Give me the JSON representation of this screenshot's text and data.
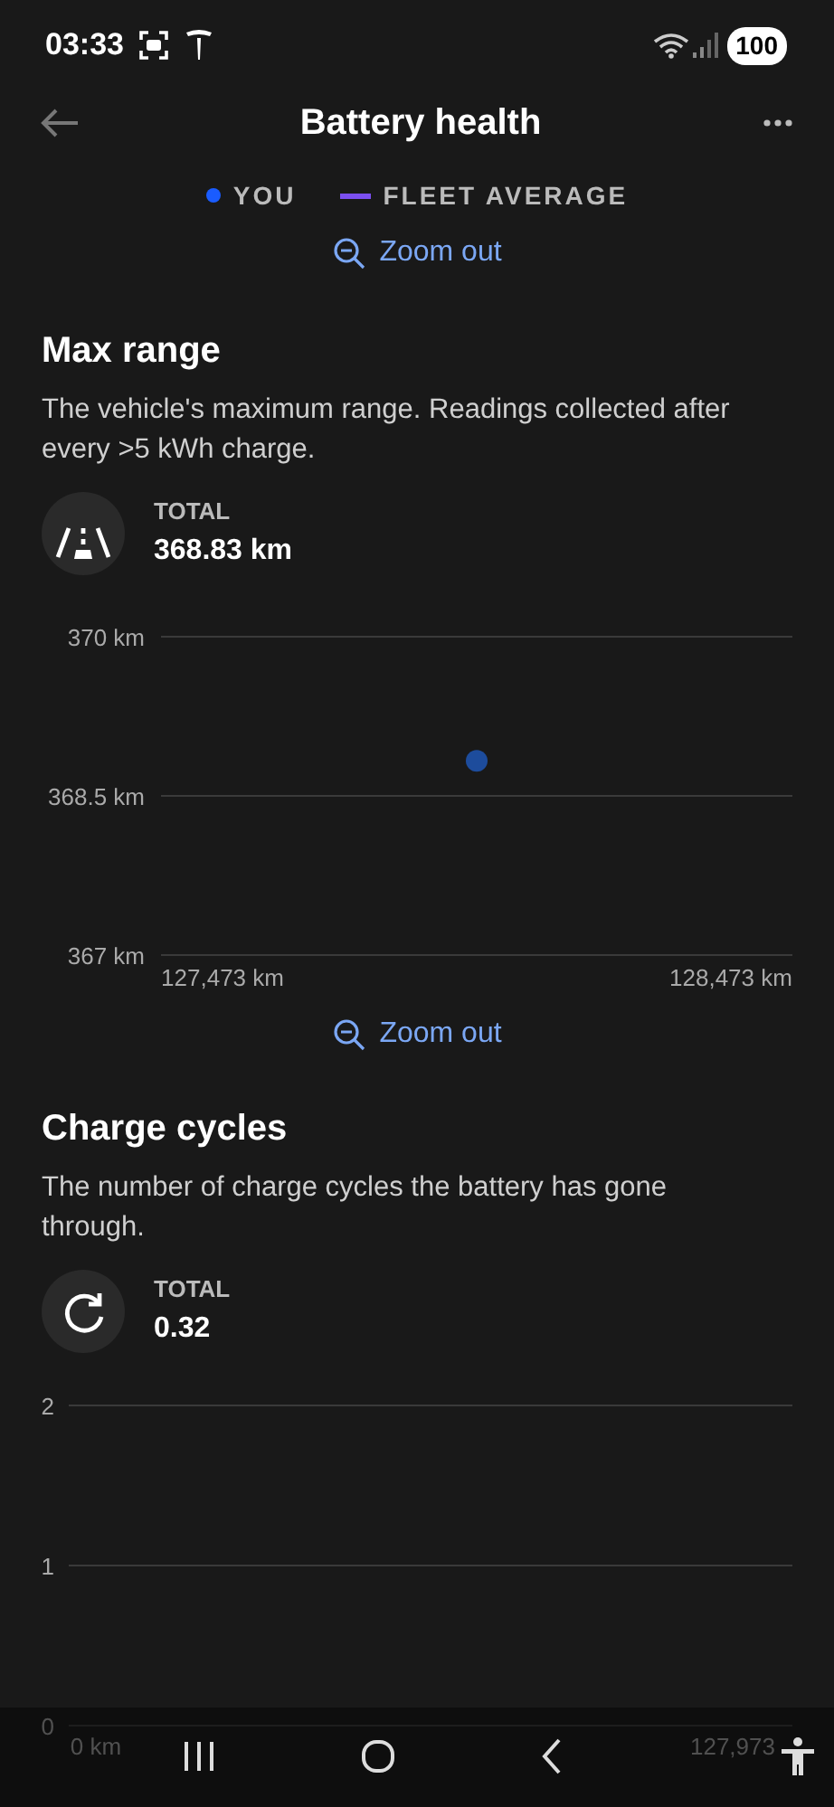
{
  "status_bar": {
    "time": "03:33",
    "battery": "100"
  },
  "header": {
    "title": "Battery health"
  },
  "legend": [
    {
      "label": "YOU",
      "color": "#1a5cff",
      "kind": "dot"
    },
    {
      "label": "FLEET AVERAGE",
      "color": "#7b4ff0",
      "kind": "line"
    }
  ],
  "sections": [
    {
      "zoom_link": "Zoom out",
      "title": "Max range",
      "description": "The vehicle's maximum range. Readings collected after every >5 kWh charge.",
      "total_label": "TOTAL",
      "total_value": "368.83 km",
      "chart_data": {
        "type": "scatter",
        "xlim": [
          127352,
          128594
        ],
        "ylim": [
          367,
          370
        ],
        "yticks": [
          {
            "value": 367,
            "label": "367 km"
          },
          {
            "value": 368.5,
            "label": "368.5 km"
          },
          {
            "value": 370,
            "label": "370 km"
          }
        ],
        "xticks": [
          {
            "value": 127473,
            "label": "127,473 km"
          },
          {
            "value": 128473,
            "label": "128,473 km"
          }
        ],
        "series": [
          {
            "color": "#1d4c9c",
            "x": [
              127973
            ],
            "values": [
              368.83
            ]
          }
        ]
      }
    },
    {
      "zoom_link": "Zoom out",
      "title": "Charge cycles",
      "description": "The number of charge cycles the battery has gone through.",
      "total_label": "TOTAL",
      "total_value": "0.32",
      "chart_data": {
        "type": "scatter",
        "xlim": [
          -5454,
          139972
        ],
        "ylim": [
          0,
          2
        ],
        "yticks": [
          0,
          1,
          2
        ],
        "xticks": [
          {
            "value": 0,
            "label": "0 km"
          },
          {
            "value": 127973,
            "label": "127,973"
          }
        ]
      }
    }
  ]
}
